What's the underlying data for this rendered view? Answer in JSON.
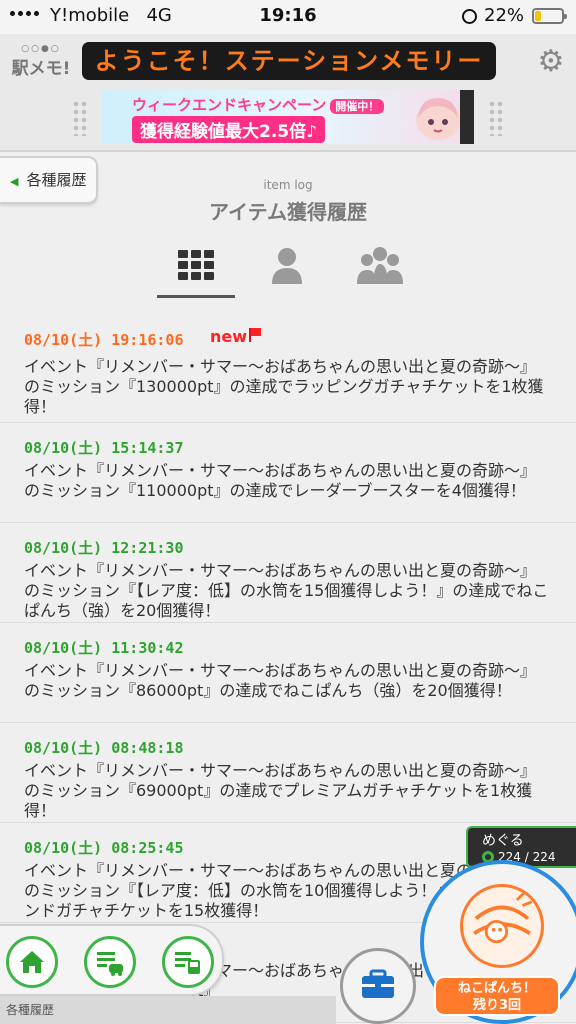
{
  "status_bar": {
    "carrier": "Y!mobile",
    "network": "4G",
    "time": "19:16",
    "battery": "22%",
    "battery_level": 0.22
  },
  "header": {
    "logo_text": "駅メモ!",
    "ticker": "ようこそ！ステーションメモリー",
    "banner": {
      "line1": "ウィークエンドキャンペーン",
      "line1_badge": "開催中！",
      "line2": "獲得経験値最大2.5倍♪"
    },
    "icons": {
      "settings": "gear-icon"
    }
  },
  "nav": {
    "back_label": "各種履歴"
  },
  "page": {
    "subtitle": "item log",
    "title": "アイテム獲得履歴"
  },
  "tabs": [
    {
      "icon": "grid-icon",
      "active": true
    },
    {
      "icon": "person-icon",
      "active": false
    },
    {
      "icon": "group-icon",
      "active": false
    }
  ],
  "entries": [
    {
      "date": "08/10(土) 19:16:06",
      "badge": "new",
      "text": "イベント『リメンバー・サマー〜おばあちゃんの思い出と夏の奇跡〜』のミッション『130000pt』の達成でラッピングガチャチケットを1枚獲得！"
    },
    {
      "date": "08/10(土) 15:14:37",
      "text": "イベント『リメンバー・サマー〜おばあちゃんの思い出と夏の奇跡〜』のミッション『110000pt』の達成でレーダーブースターを4個獲得！"
    },
    {
      "date": "08/10(土) 12:21:30",
      "text": "イベント『リメンバー・サマー〜おばあちゃんの思い出と夏の奇跡〜』のミッション『【レア度：低】の水筒を15個獲得しよう！』の達成でねこぱんち（強）を20個獲得！"
    },
    {
      "date": "08/10(土) 11:30:42",
      "text": "イベント『リメンバー・サマー〜おばあちゃんの思い出と夏の奇跡〜』のミッション『86000pt』の達成でねこぱんち（強）を20個獲得！"
    },
    {
      "date": "08/10(土) 08:48:18",
      "text": "イベント『リメンバー・サマー〜おばあちゃんの思い出と夏の奇跡〜』のミッション『69000pt』の達成でプレミアムガチャチケットを1枚獲得！"
    },
    {
      "date": "08/10(土) 08:25:45",
      "text": "イベント『リメンバー・サマー〜おばあちゃんの思い出と夏の奇跡〜』のミッション『【レア度：低】の水筒を10個獲得しよう！』の達成でフレンドガチャチケットを15枚獲得！"
    },
    {
      "date": "",
      "text": "イベント『リメンバー・サマー〜おばあちゃんの思い出と夏の奇跡〜』のミッション『55000pt』"
    }
  ],
  "bottom": {
    "caption": "各種履歴",
    "buttons": [
      {
        "icon": "home-icon"
      },
      {
        "icon": "list-train-icon"
      },
      {
        "icon": "list-station-icon"
      }
    ],
    "briefcase_icon": "briefcase-icon"
  },
  "character": {
    "name": "めぐる",
    "hp": "224 / 224"
  },
  "punch": {
    "label_line1": "ねこぱんち！",
    "label_line2": "残り3回"
  },
  "colors": {
    "accent_green": "#3eb548",
    "date_green": "#2fa32f",
    "date_orange": "#ff6a1a",
    "new_red": "#ff2222",
    "ticker_orange": "#ff7b1a",
    "punch_orange": "#ff7a2a",
    "punch_ring_blue": "#2b8de0"
  }
}
